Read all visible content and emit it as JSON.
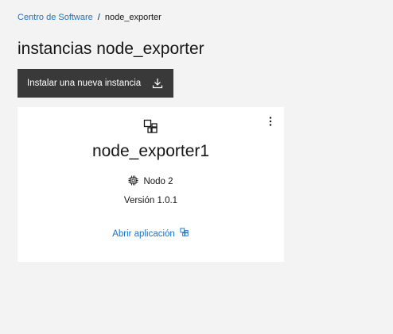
{
  "breadcrumb": {
    "parent": "Centro de Software",
    "separator": "/",
    "current": "node_exporter"
  },
  "page_title": "instancias node_exporter",
  "install_button": {
    "label": "Instalar una nueva instancia",
    "icon": "download-icon"
  },
  "card": {
    "menu_icon": "overflow-menu-icon",
    "app_icon": "application-icon",
    "instance_name": "node_exporter1",
    "node_icon": "chip-icon",
    "node_label": "Nodo 2",
    "version": "Versión 1.0.1",
    "open_link": "Abrir aplicación",
    "open_icon": "application-icon"
  },
  "colors": {
    "background": "#f3f3f3",
    "button": "#393939",
    "link": "#1a73c8",
    "card": "#ffffff"
  }
}
